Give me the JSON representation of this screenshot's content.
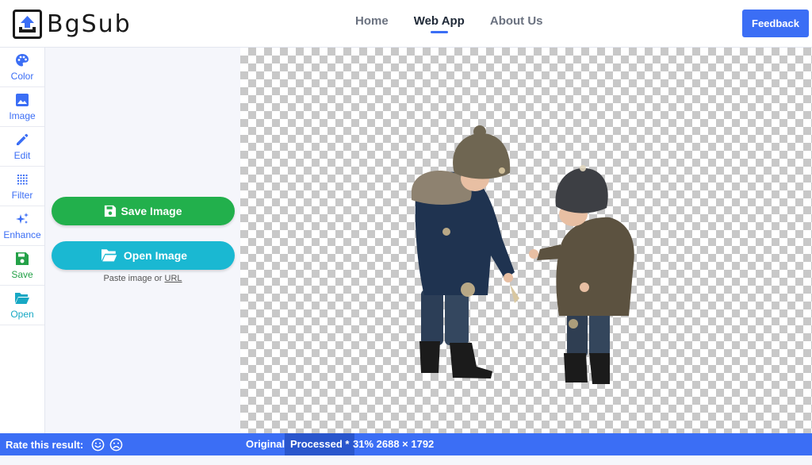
{
  "app": {
    "logo_text": "BgSub"
  },
  "nav": {
    "items": [
      {
        "label": "Home",
        "active": false
      },
      {
        "label": "Web App",
        "active": true
      },
      {
        "label": "About Us",
        "active": false
      }
    ],
    "feedback_label": "Feedback"
  },
  "rail": {
    "items": [
      {
        "label": "Color",
        "icon": "palette-icon"
      },
      {
        "label": "Image",
        "icon": "image-icon"
      },
      {
        "label": "Edit",
        "icon": "pencil-icon"
      },
      {
        "label": "Filter",
        "icon": "grid-dots-icon"
      },
      {
        "label": "Enhance",
        "icon": "sparkles-icon"
      },
      {
        "label": "Save",
        "icon": "floppy-disk-icon"
      },
      {
        "label": "Open",
        "icon": "folder-open-icon"
      }
    ]
  },
  "panel": {
    "save_label": "Save Image",
    "open_label": "Open Image",
    "paste_text": "Paste image or ",
    "paste_link": "URL"
  },
  "statusbar": {
    "rate_label": "Rate this result:",
    "original_label": "Original",
    "processed_label": "Processed *",
    "zoom_info": "31% 2688 × 1792"
  },
  "colors": {
    "accent": "#3b6ef5",
    "save_green": "#22b04c",
    "open_cyan": "#1ab8d2"
  }
}
